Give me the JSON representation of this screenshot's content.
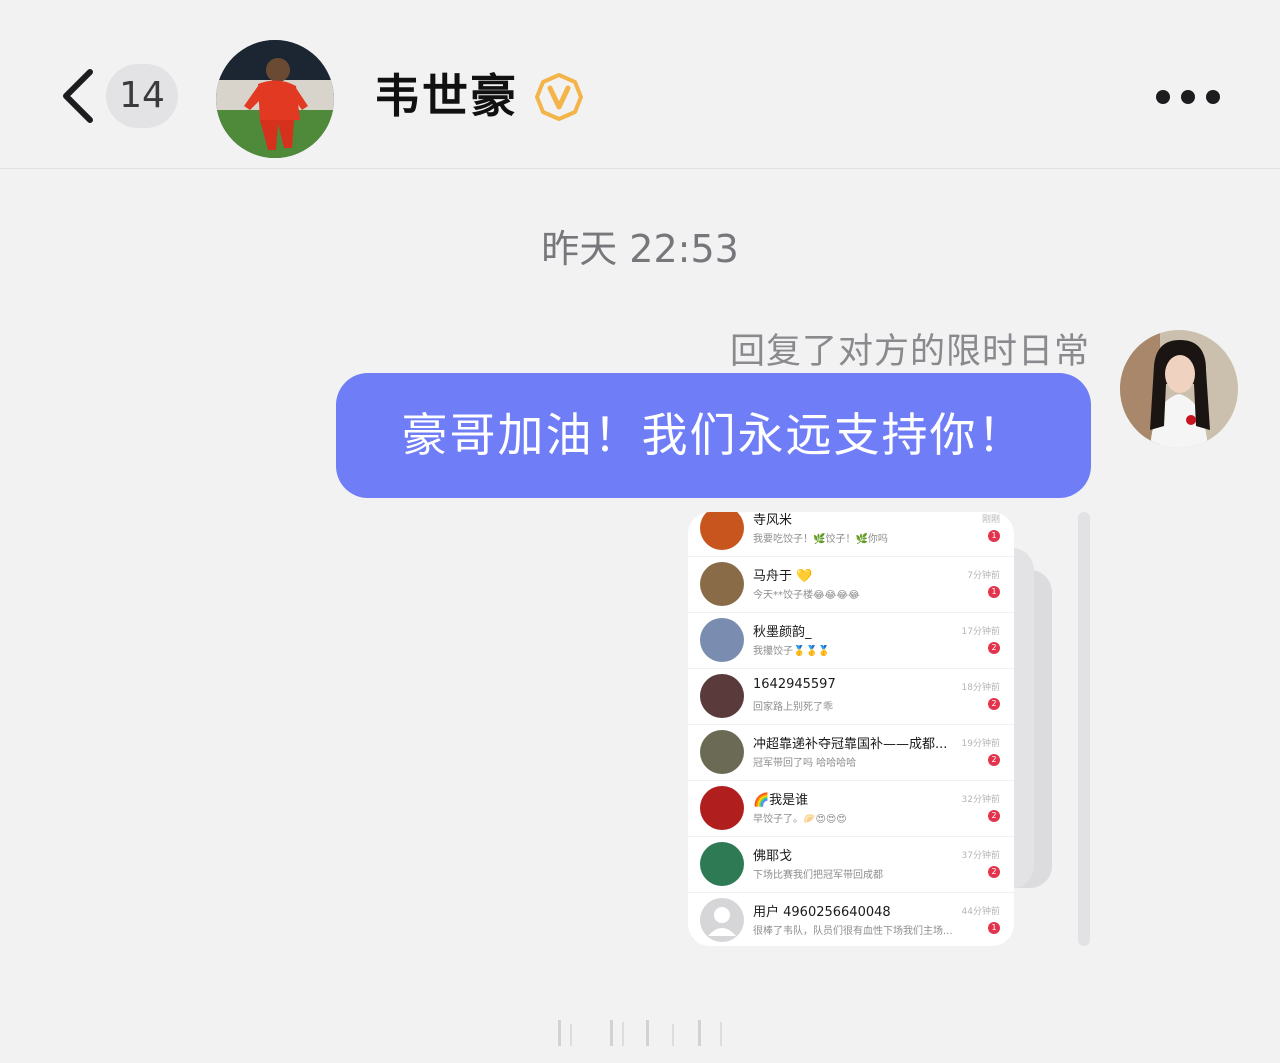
{
  "header": {
    "unread_count": "14",
    "contact_name": "韦世豪",
    "icons": {
      "back": "chevron-left-icon",
      "verified": "verified-v-badge-icon",
      "more": "more-dots-icon"
    },
    "colors": {
      "verified": "#f3b54a"
    }
  },
  "chat": {
    "timestamp": "昨天 22:53",
    "reply_note": "回复了对方的限时日常",
    "message": "豪哥加油！我们永远支持你！",
    "colors": {
      "bubble": "#6f7df7"
    }
  },
  "shared_image": {
    "rows": [
      {
        "name": "寺风米",
        "message": "我要吃饺子！🌿饺子！🌿你吗",
        "time": "刚刚",
        "count": "1",
        "avatar_color": "#c8551e"
      },
      {
        "name": "马舟于 💛",
        "message": "今天**饺子楼😂😂😂😂",
        "time": "7分钟前",
        "count": "1",
        "avatar_color": "#8a6b48"
      },
      {
        "name": "秋墨颜韵_",
        "message": "我攥饺子🥇🥇🥇",
        "time": "17分钟前",
        "count": "2",
        "avatar_color": "#7a8db0"
      },
      {
        "name": "1642945597",
        "message": "回家路上别死了乖",
        "time": "18分钟前",
        "count": "2",
        "avatar_color": "#5a3a3a"
      },
      {
        "name": "冲超靠递补夺冠靠国补——成都...",
        "message": "冠军带回了吗 哈哈哈哈",
        "time": "19分钟前",
        "count": "2",
        "avatar_color": "#6b6b55"
      },
      {
        "name": "🌈我是谁",
        "message": "早饺子了。🥟😍😍😍",
        "time": "32分钟前",
        "count": "2",
        "avatar_color": "#b01e1e"
      },
      {
        "name": "佛耶戈",
        "message": "下场比赛我们把冠军带回成都",
        "time": "37分钟前",
        "count": "2",
        "avatar_color": "#2e7a55"
      },
      {
        "name": "用户 4960256640048",
        "message": "很棒了韦队，队员们很有血性下场我们主场...",
        "time": "44分钟前",
        "count": "1",
        "avatar_color": "#d6d6d9"
      }
    ]
  }
}
